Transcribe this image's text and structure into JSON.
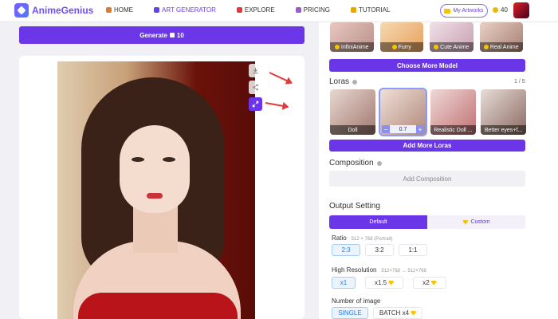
{
  "header": {
    "logo_text": "AnimeGenius",
    "nav": [
      {
        "label": "HOME",
        "icon": "home-icon",
        "color": "#e07a2a"
      },
      {
        "label": "ART GENERATOR",
        "icon": "art-generator-icon",
        "color": "#6a3ff0"
      },
      {
        "label": "EXPLORE",
        "icon": "explore-icon",
        "color": "#e23a3a"
      },
      {
        "label": "PRICING",
        "icon": "pricing-icon",
        "color": "#9b59d6"
      },
      {
        "label": "TUTORIAL",
        "icon": "tutorial-icon",
        "color": "#e8a800"
      }
    ],
    "my_artworks_label": "My Artworks",
    "credits": "40"
  },
  "generate": {
    "label_prefix": "Generate",
    "cost": "10"
  },
  "models": [
    {
      "label": "InfiniAnime",
      "starred": true
    },
    {
      "label": "Furry",
      "starred": true
    },
    {
      "label": "Cute Anime",
      "starred": true
    },
    {
      "label": "Real Anime",
      "starred": true
    }
  ],
  "choose_more_model": "Choose More Model",
  "loras": {
    "title": "Loras",
    "count": "1 / 5",
    "items": [
      {
        "label": "Doll"
      },
      {
        "label": "0.7",
        "stepper": true,
        "minus": "−",
        "plus": "+"
      },
      {
        "label": "Realistic Doll ..."
      },
      {
        "label": "Better eyes+f..."
      }
    ],
    "add_label": "Add More Loras"
  },
  "composition": {
    "title": "Composition",
    "add_label": "Add Composition"
  },
  "output": {
    "title": "Output Setting",
    "tab_default": "Default",
    "tab_custom": "Custom",
    "ratio": {
      "label": "Ratio",
      "hint": "512 × 768 (Portrait)",
      "options": [
        "2:3",
        "3:2",
        "1:1"
      ],
      "selected": "2:3"
    },
    "high_res": {
      "label": "High Resolution",
      "hint": "512×768 → 512×768",
      "options": [
        "x1",
        "x1.5",
        "x2"
      ],
      "selected": "x1"
    },
    "num_images": {
      "label": "Number of image",
      "options": [
        "SINGLE",
        "BATCH x4"
      ],
      "selected": "SINGLE"
    }
  },
  "colors": {
    "accent": "#6a36e8",
    "annotation_arrow": "#e23a3a"
  }
}
